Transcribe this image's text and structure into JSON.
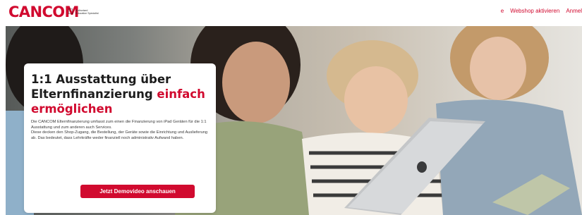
{
  "header": {
    "brand": "CANCOM",
    "partner_badge": {
      "icon": "apple-icon",
      "line1": "Authorised",
      "line2": "Education Specialist"
    },
    "nav": [
      "e",
      "Webshop aktivieren",
      "Anmel"
    ]
  },
  "hero": {
    "title_part1": "1:1 Ausstattung über Elternfinanzierung",
    "title_accent_inline": "einfach",
    "title_accent_line": "ermöglichen",
    "body": [
      "Die CANCOM Elternfinanzierung umfasst zum einen die Finanzierung von iPad Geräten für die 1:1 Ausstattung und zum anderen auch Services.",
      "Diese decken den Shop-Zugang, die Bestellung, der Geräte sowie die Einrichtung und Auslieferung ab. Das bedeutet, dass Lehrkräfte weder finanziell noch administrativ Aufwand haben."
    ],
    "cta_label": "Jetzt Demovideo anschauen"
  },
  "colors": {
    "brand_red": "#d10a2f",
    "text_dark": "#1c1c1c"
  }
}
